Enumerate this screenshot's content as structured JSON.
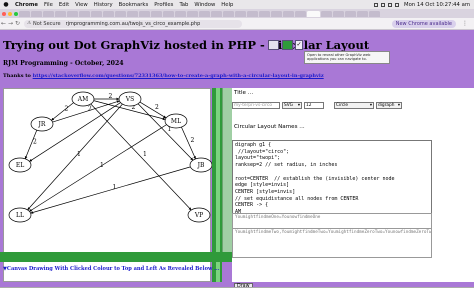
{
  "menubar": {
    "app": "Chrome",
    "items": [
      "File",
      "Edit",
      "View",
      "History",
      "Bookmarks",
      "Profiles",
      "Tab",
      "Window",
      "Help"
    ],
    "clock": "Mon 14 Oct  10:27:44 am"
  },
  "browser": {
    "security_label": "Not Secure",
    "url": "rjmprogramming.com.au/twojs_vs_circo_example.php",
    "new_chrome_label": "New Chrome available"
  },
  "page": {
    "title": "Trying out Dot GraphViz hosted in PHP - Circular Layout",
    "subtitle": "RJM Programming - October, 2024",
    "thanks_prefix": "Thanks to ",
    "thanks_link": "https://stackoverflow.com/questions/72331363/how-to-create-a-graph-with-a-circular-layout-in-graphviz",
    "tooltip": "Open to reveal other GraphViz web applications you can navigate to.",
    "footer": "▼Canvas Drawing With Clicked Colour to Top and Left As Revealed Below ..."
  },
  "form": {
    "title_label": "Title ...",
    "title_placeholder": "my-terpri-vs-circo",
    "format_value": "SVG",
    "size_value": "12",
    "shape_value": "Circle",
    "graph_type_value": "digraph",
    "names_label": "Circular Layout Names ...",
    "code": "digraph g1 {\n //layout=\"circo\";\nlayout=\"twopi\";\nranksep=2 // set radius, in inches\n\nroot=CENTER  // establish the (invisible) center node\nedge [style=invis]\nCENTER [style=invis]\n// set equidistance all nodes from CENTER\nCENTER -> {\nAM\nVS\nML\nJR\nEL\nPP",
    "node_list_1": "YoumightfindmeOne=YounowfindmeOne",
    "node_list_2": "YoumightfindmeTwo,YoumightfindmeTwo=YoumightfindmeZeroTwo=YounowfindmeZeroTwo",
    "draw_button": "Draw"
  },
  "graph": {
    "nodes": [
      {
        "id": "AM",
        "label": "AM"
      },
      {
        "id": "VS",
        "label": "VS"
      },
      {
        "id": "JR",
        "label": "JR"
      },
      {
        "id": "ML",
        "label": "ML"
      },
      {
        "id": "EL",
        "label": "EL"
      },
      {
        "id": "JB",
        "label": "JB"
      },
      {
        "id": "LL",
        "label": "LL"
      },
      {
        "id": "VP",
        "label": "VP"
      }
    ],
    "edges": [
      {
        "from": "AM",
        "to": "VS",
        "label": "2"
      },
      {
        "from": "AM",
        "to": "JR",
        "label": "2"
      },
      {
        "from": "JR",
        "to": "VS",
        "label": "2"
      },
      {
        "from": "AM",
        "to": "ML",
        "label": "2"
      },
      {
        "from": "VS",
        "to": "ML",
        "label": "2"
      },
      {
        "from": "JR",
        "to": "EL",
        "label": "2"
      },
      {
        "from": "VS",
        "to": "JB",
        "label": "1"
      },
      {
        "from": "ML",
        "to": "JB",
        "label": "2"
      },
      {
        "from": "ML",
        "to": "LL",
        "label": "1"
      },
      {
        "from": "VS",
        "to": "LL",
        "label": "1"
      },
      {
        "from": "JB",
        "to": "LL",
        "label": "1"
      },
      {
        "from": "AM",
        "to": "VP",
        "label": "1"
      },
      {
        "from": "VS",
        "to": "EL",
        "label": ""
      }
    ]
  },
  "colors": {
    "page_bg": "#a978d6",
    "green": "#2f9a3a",
    "link": "#1b1bcc"
  }
}
